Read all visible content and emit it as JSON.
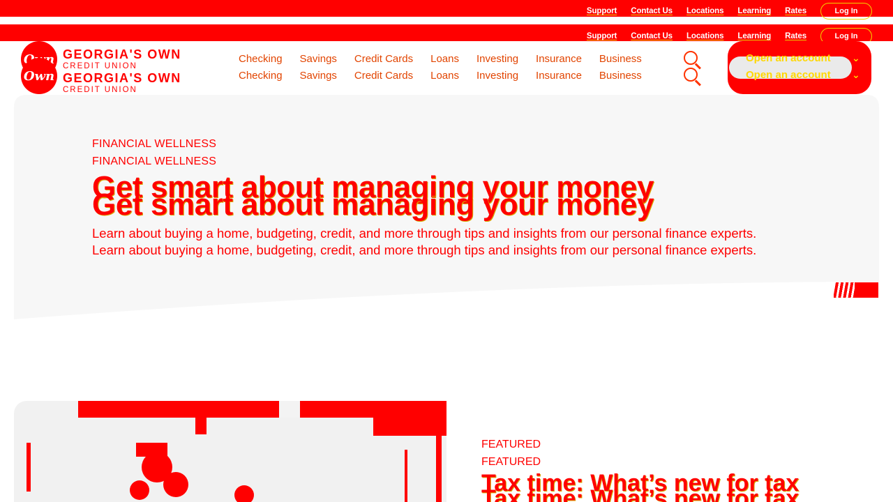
{
  "utility": {
    "links": [
      "Support",
      "Contact Us",
      "Locations",
      "Learning",
      "Rates"
    ],
    "login": "Log In"
  },
  "brand": {
    "logo_mark": "Own",
    "name": "GEORGIA'S OWN",
    "subtitle": "CREDIT UNION"
  },
  "nav": {
    "items": [
      "Checking",
      "Savings",
      "Credit Cards",
      "Loans",
      "Investing",
      "Insurance",
      "Business"
    ],
    "search_icon": "search-icon",
    "open_account": "Open an account",
    "open_account_chevron": "⌄"
  },
  "hero": {
    "eyebrow": "FINANCIAL WELLNESS",
    "title": "Get smart about managing your money",
    "description": "Learn about buying a home, budgeting, credit, and more through tips and insights from our personal finance experts."
  },
  "featured": {
    "eyebrow": "FEATURED",
    "title": "Tax time: What’s new for tax"
  },
  "colors": {
    "brand_red": "#ff0000",
    "accent_yellow": "#f2d600",
    "nav_text": "#e24400"
  }
}
